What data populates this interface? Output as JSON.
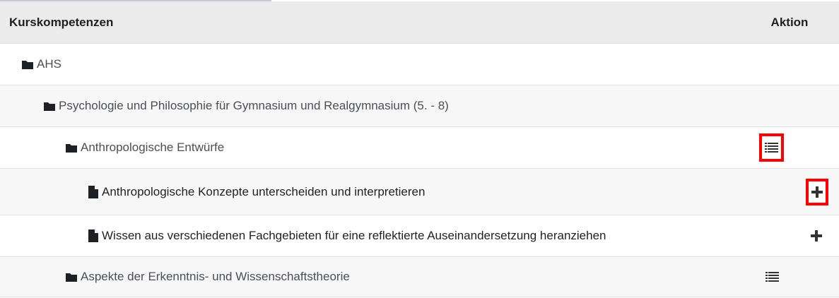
{
  "table": {
    "header": {
      "name": "Kurskompetenzen",
      "action": "Aktion"
    },
    "rows": [
      {
        "label": "AHS",
        "icon": "folder-icon",
        "action_icon": ""
      },
      {
        "label": "Psychologie und Philosophie für Gymnasium und Realgymnasium (5. - 8)",
        "icon": "folder-icon",
        "action_icon": ""
      },
      {
        "label": "Anthropologische Entwürfe",
        "icon": "folder-icon",
        "action_icon": "list-icon",
        "highlighted": true
      },
      {
        "label": "Anthropologische Konzepte unterscheiden und interpretieren",
        "icon": "file-icon",
        "action_icon": "plus-icon",
        "highlighted": true
      },
      {
        "label": "Wissen aus verschiedenen Fachgebieten für eine reflektierte Auseinandersetzung heranziehen",
        "icon": "file-icon",
        "action_icon": "plus-icon"
      },
      {
        "label": "Aspekte der Erkenntnis- und Wissenschaftstheorie",
        "icon": "folder-icon",
        "action_icon": "list-icon"
      }
    ]
  },
  "colors": {
    "highlight": "#ff0000",
    "header_bg": "#ebebeb",
    "stripe_bg": "#f7f7f7"
  }
}
